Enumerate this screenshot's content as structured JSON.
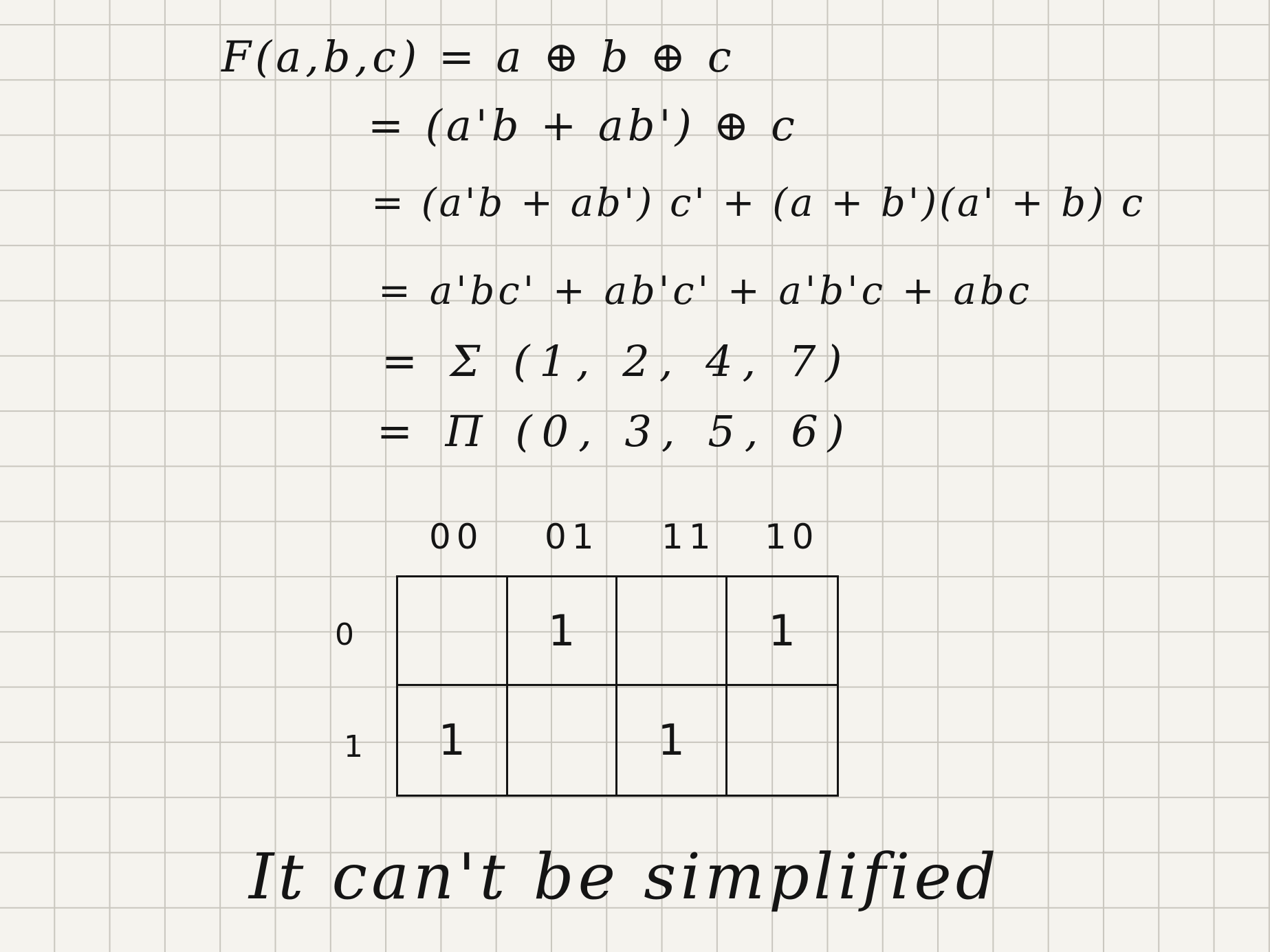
{
  "equations": [
    "F(a,b,c) = a ⊕ b ⊕ c",
    "= (a'b + ab') ⊕ c",
    "= (a'b + ab') c' + (a + b')(a' + b) c",
    "= a'bc' + ab'c' + a'b'c + abc",
    "= Σ (1, 2, 4, 7)",
    "= Π (0, 3, 5, 6)"
  ],
  "kmap": {
    "col_labels": [
      "00",
      "01",
      "11",
      "10"
    ],
    "row_labels": [
      "0",
      "1"
    ],
    "cells": [
      [
        "",
        "1",
        "",
        "1"
      ],
      [
        "1",
        "",
        "1",
        ""
      ]
    ]
  },
  "conclusion": "It can't be simplified"
}
